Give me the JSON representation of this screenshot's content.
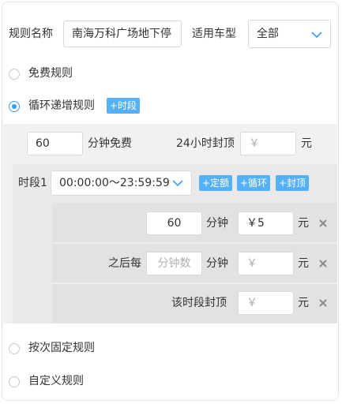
{
  "header": {
    "rule_name_label": "规则名称",
    "rule_name_value": "南海万科广场地下停",
    "vehicle_type_label": "适用车型",
    "vehicle_type_value": "全部"
  },
  "rules": {
    "free": "免费规则",
    "cycle": "循环递增规则",
    "fixed": "按次固定规则",
    "custom": "自定义规则"
  },
  "cycle": {
    "add_period_tag": "+时段",
    "free_minutes_value": "60",
    "free_minutes_label": "分钟免费",
    "cap24_label": "24小时封顶",
    "cap24_placeholder": "￥",
    "yuan": "元"
  },
  "period": {
    "label": "时段1",
    "time_range": "00:00:00～23:59:59",
    "tag_fixed": "+定额",
    "tag_cycle": "+循环",
    "tag_cap": "+封顶",
    "row1": {
      "minutes": "60",
      "minutes_label": "分钟",
      "price": "￥5",
      "unit": "元"
    },
    "row2": {
      "prefix": "之后每",
      "minutes_placeholder": "分钟数",
      "minutes_label": "分钟",
      "price_placeholder": "￥",
      "unit": "元"
    },
    "row3": {
      "label": "该时段封顶",
      "price_placeholder": "￥",
      "unit": "元"
    }
  },
  "colors": {
    "accent": "#3b9cf5",
    "tag": "#55b0f5"
  }
}
